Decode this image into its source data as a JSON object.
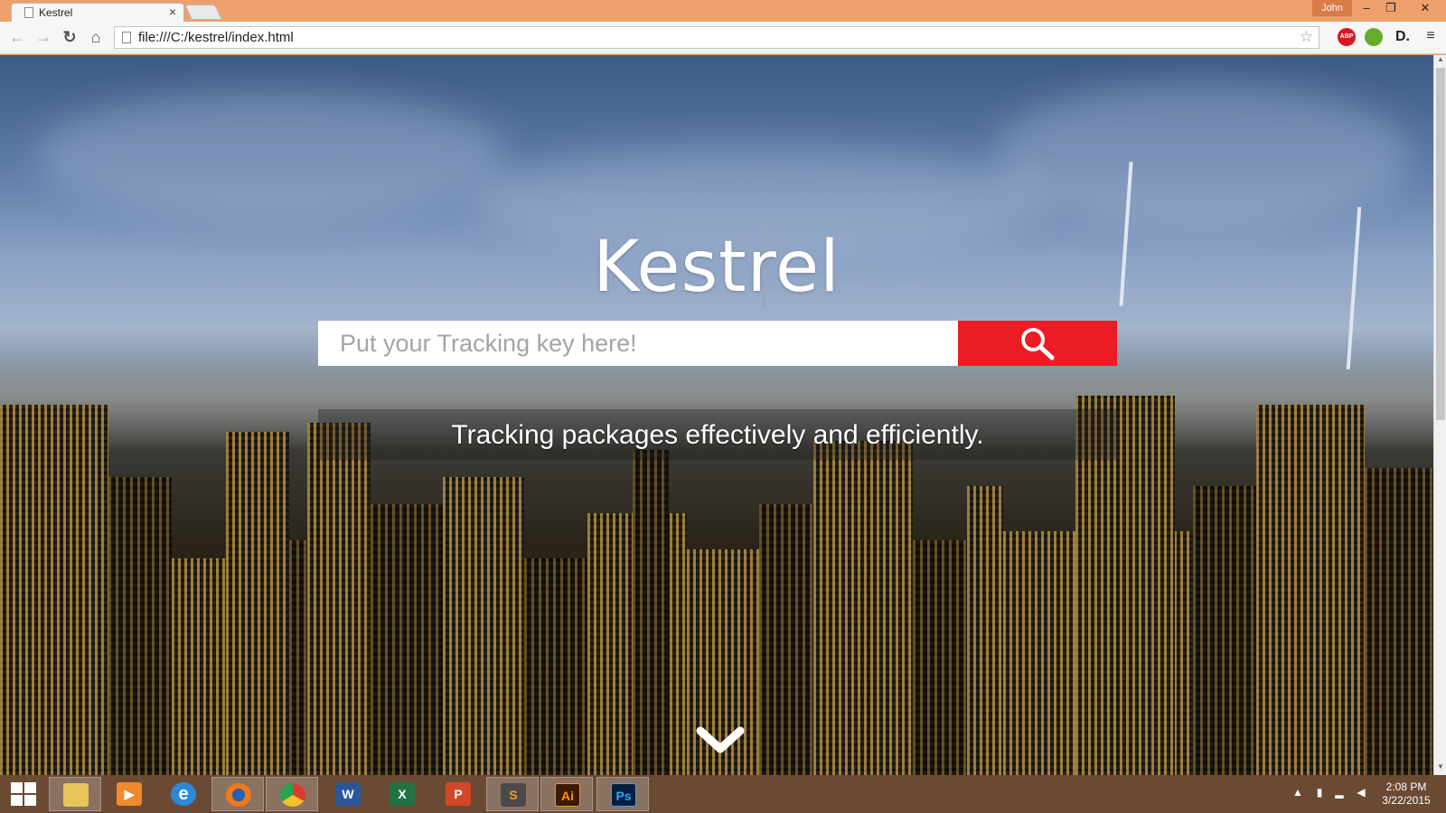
{
  "browser": {
    "tab_title": "Kestrel",
    "tab_close": "×",
    "user_name": "John",
    "window_controls": {
      "minimize": "–",
      "maximize": "❐",
      "close": "✕"
    },
    "url": "file:///C:/kestrel/index.html",
    "extensions": {
      "abp_label": "ABP",
      "d_label": "D."
    },
    "icons": [
      "back-arrow-icon",
      "forward-arrow-icon",
      "reload-icon",
      "home-icon",
      "bookmark-star-icon",
      "menu-icon"
    ]
  },
  "page": {
    "title": "Kestrel",
    "search": {
      "placeholder": "Put your Tracking key here!"
    },
    "tagline": "Tracking packages effectively and efficiently.",
    "colors": {
      "accent": "#ec1c24",
      "text": "#ffffff"
    }
  },
  "taskbar": {
    "apps": [
      {
        "name": "file-explorer",
        "glyph": ""
      },
      {
        "name": "media-player",
        "glyph": "▶"
      },
      {
        "name": "internet-explorer",
        "glyph": "e"
      },
      {
        "name": "firefox",
        "glyph": ""
      },
      {
        "name": "chrome",
        "glyph": ""
      },
      {
        "name": "word",
        "glyph": "W"
      },
      {
        "name": "excel",
        "glyph": "X"
      },
      {
        "name": "powerpoint",
        "glyph": "P"
      },
      {
        "name": "sublime-text",
        "glyph": "S"
      },
      {
        "name": "illustrator",
        "glyph": "Ai"
      },
      {
        "name": "photoshop",
        "glyph": "Ps"
      }
    ],
    "clock_time": "2:08 PM",
    "clock_date": "3/22/2015"
  }
}
